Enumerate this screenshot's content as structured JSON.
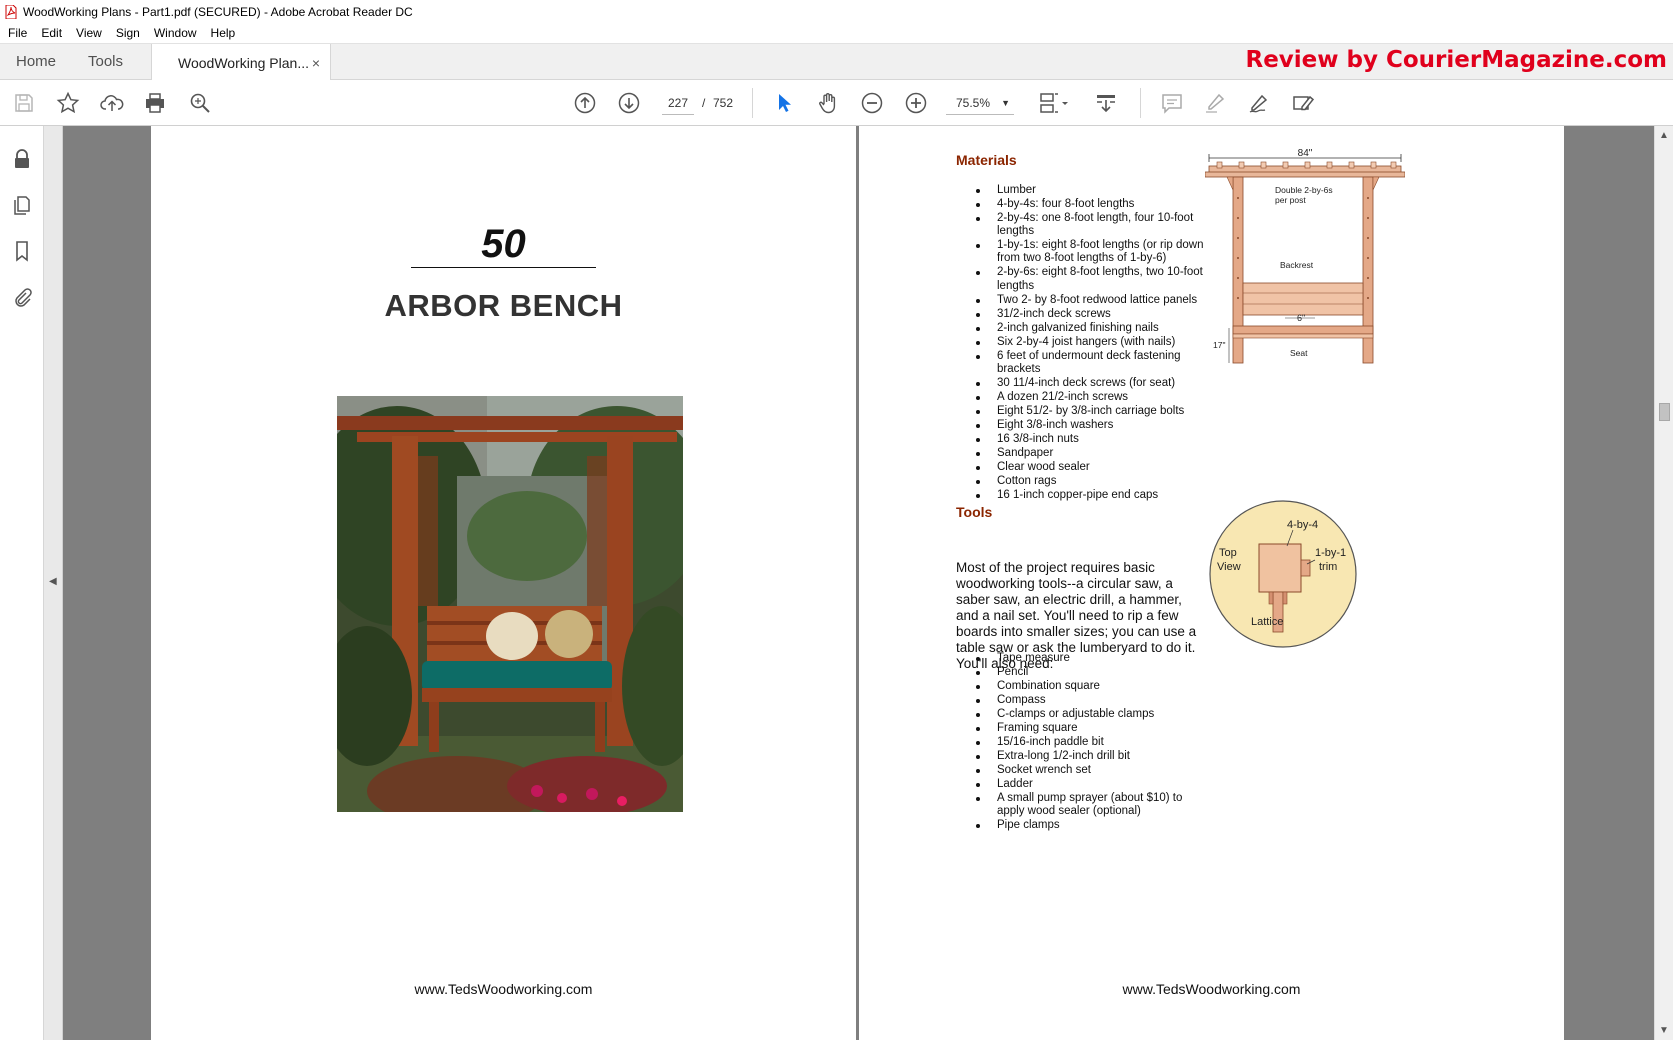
{
  "window": {
    "title": "WoodWorking Plans - Part1.pdf (SECURED) - Adobe Acrobat Reader DC"
  },
  "menu": [
    "File",
    "Edit",
    "View",
    "Sign",
    "Window",
    "Help"
  ],
  "tabs": {
    "home": "Home",
    "tools": "Tools",
    "document": "WoodWorking Plan...",
    "close": "×"
  },
  "promo": "Review by CourierMagazine.com",
  "toolbar": {
    "current_page": "227",
    "page_separator": "/",
    "total_pages": "752",
    "zoom": "75.5%"
  },
  "left_page": {
    "number": "50",
    "title": "ARBOR BENCH",
    "footer": "www.TedsWoodworking.com"
  },
  "right_page": {
    "materials_heading": "Materials",
    "materials": [
      "Lumber",
      "4-by-4s: four 8-foot lengths",
      "2-by-4s: one 8-foot length, four 10-foot lengths",
      "1-by-1s: eight 8-foot lengths (or rip down from two 8-foot lengths of 1-by-6)",
      "2-by-6s: eight 8-foot lengths, two 10-foot lengths",
      "Two 2- by 8-foot redwood lattice panels",
      "31/2-inch deck screws",
      "2-inch galvanized finishing nails",
      "Six 2-by-4 joist hangers (with nails)",
      "6 feet of undermount deck fastening brackets",
      "30 11/4-inch deck screws (for seat)",
      "A dozen 21/2-inch screws",
      "Eight 51/2- by 3/8-inch carriage bolts",
      "Eight 3/8-inch washers",
      "16 3/8-inch nuts",
      "Sandpaper",
      "Clear wood sealer",
      "Cotton rags",
      "16 1-inch copper-pipe end caps"
    ],
    "tools_heading": "Tools",
    "tools_intro": "Most of the project requires basic woodworking tools--a circular saw, a saber saw, an electric drill, a hammer, and a nail set. You'll need to rip a few boards into smaller sizes; you can use a table saw or ask the lumberyard to do it. You'll also need:",
    "tools": [
      "Tape measure",
      "Pencil",
      "Combination square",
      "Compass",
      "C-clamps or adjustable clamps",
      "Framing square",
      "15/16-inch paddle bit",
      "Extra-long 1/2-inch drill bit",
      "Socket wrench set",
      "Ladder",
      "A small pump sprayer (about $10) to apply wood sealer (optional)",
      "Pipe clamps"
    ],
    "diagram_labels": {
      "width": "84\"",
      "post": "Double 2-by-6s per post",
      "backrest": "Backrest",
      "gap": "6\"",
      "height": "17\"",
      "seat": "Seat"
    },
    "detail_labels": {
      "post": "4-by-4",
      "view": "Top View",
      "trim": "1-by-1 trim",
      "lattice": "Lattice"
    },
    "footer": "www.TedsWoodworking.com"
  },
  "colors": {
    "promo": "#e0001c",
    "section_heading": "#8b2500",
    "viewer_bg": "#7f7f7f",
    "select_tool": "#1473e6"
  },
  "icons": [
    "save-icon",
    "bookmark-star-icon",
    "upload-icon",
    "print-icon",
    "find-icon",
    "previous-page-icon",
    "next-page-icon",
    "select-arrow-icon",
    "hand-icon",
    "zoom-out-icon",
    "zoom-in-icon",
    "page-display-icon",
    "scroll-mode-icon",
    "comment-icon",
    "highlight-icon",
    "sign-icon",
    "fill-sign-icon",
    "lock-icon",
    "pages-icon",
    "bookmarks-icon",
    "attachments-icon"
  ]
}
